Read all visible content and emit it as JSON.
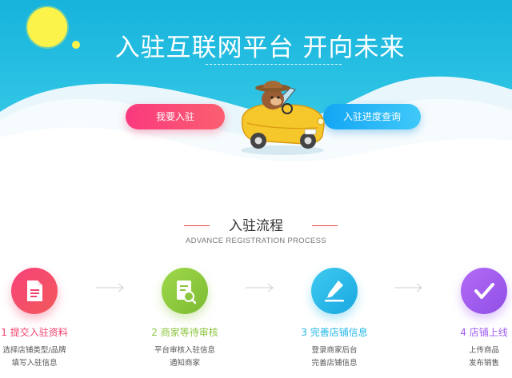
{
  "hero": {
    "title": "入驻互联网平台 开向未来",
    "join_button": "我要入驻",
    "progress_button": "入驻进度查询"
  },
  "process": {
    "title": "入驻流程",
    "subtitle": "ADVANCE REGISTRATION PROCESS",
    "steps": [
      {
        "title": "1 提交入驻资料",
        "lines": [
          "选择店铺类型/品牌",
          "填写入驻信息"
        ],
        "color": "#f0416d",
        "icon": "document-icon"
      },
      {
        "title": "2 商家等待审核",
        "lines": [
          "平台审核入驻信息",
          "通知商家"
        ],
        "color": "#8cc63f",
        "icon": "review-icon"
      },
      {
        "title": "3 完善店铺信息",
        "lines": [
          "登录商家后台",
          "完善店铺信息"
        ],
        "color": "#26b8e8",
        "icon": "edit-icon"
      },
      {
        "title": "4 店铺上线",
        "lines": [
          "上传商品",
          "发布销售"
        ],
        "color": "#a05cf0",
        "icon": "check-icon"
      }
    ]
  },
  "colors": {
    "pink": "#f0416d",
    "green": "#8cc63f",
    "blue": "#26b8e8",
    "purple": "#a05cf0",
    "sky": "#1db6df"
  }
}
